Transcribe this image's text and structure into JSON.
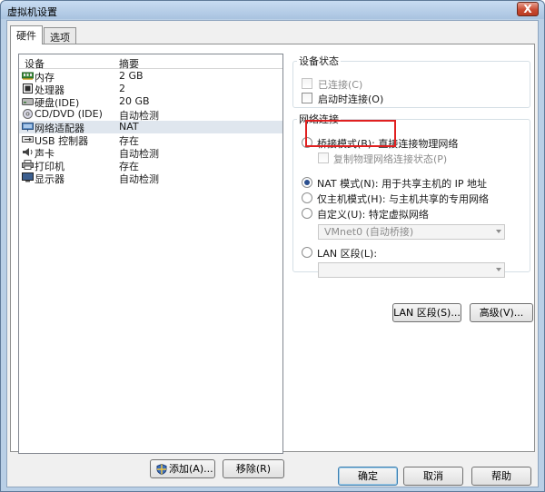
{
  "window": {
    "title": "虚拟机设置",
    "close_label": "X"
  },
  "tabs": [
    {
      "label": "硬件"
    },
    {
      "label": "选项"
    }
  ],
  "device_list": {
    "header_device": "设备",
    "header_summary": "摘要",
    "rows": [
      {
        "name": "内存",
        "summary": "2 GB",
        "icon": "memory-icon"
      },
      {
        "name": "处理器",
        "summary": "2",
        "icon": "processor-icon"
      },
      {
        "name": "硬盘(IDE)",
        "summary": "20 GB",
        "icon": "hard-disk-icon"
      },
      {
        "name": "CD/DVD (IDE)",
        "summary": "自动检测",
        "icon": "cd-dvd-icon"
      },
      {
        "name": "网络适配器",
        "summary": "NAT",
        "icon": "network-adapter-icon"
      },
      {
        "name": "USB 控制器",
        "summary": "存在",
        "icon": "usb-icon"
      },
      {
        "name": "声卡",
        "summary": "自动检测",
        "icon": "sound-card-icon"
      },
      {
        "name": "打印机",
        "summary": "存在",
        "icon": "printer-icon"
      },
      {
        "name": "显示器",
        "summary": "自动检测",
        "icon": "display-icon"
      }
    ],
    "selected": "网络适配器"
  },
  "device_buttons": {
    "add_label": "添加(A)...",
    "remove_label": "移除(R)"
  },
  "device_status": {
    "legend": "设备状态",
    "connected_label": "已连接(C)",
    "connect_at_power_on_label": "启动时连接(O)"
  },
  "network": {
    "legend": "网络连接",
    "bridged_label": "桥接模式(B): 直接连接物理网络",
    "replicate_label": "复制物理网络连接状态(P)",
    "nat_label": "NAT 模式(N): 用于共享主机的 IP 地址",
    "host_only_label": "仅主机模式(H): 与主机共享的专用网络",
    "custom_label": "自定义(U): 特定虚拟网络",
    "custom_value": "VMnet0 (自动桥接)",
    "lan_segment_label": "LAN 区段(L):",
    "lan_segment_value": "",
    "selected_mode": "NAT"
  },
  "network_buttons": {
    "lan_segments_label": "LAN 区段(S)...",
    "advanced_label": "高级(V)..."
  },
  "dialog_buttons": {
    "ok_label": "确定",
    "cancel_label": "取消",
    "help_label": "帮助"
  },
  "colors": {
    "highlight": "#e02020",
    "selection": "#dfe6ee"
  }
}
